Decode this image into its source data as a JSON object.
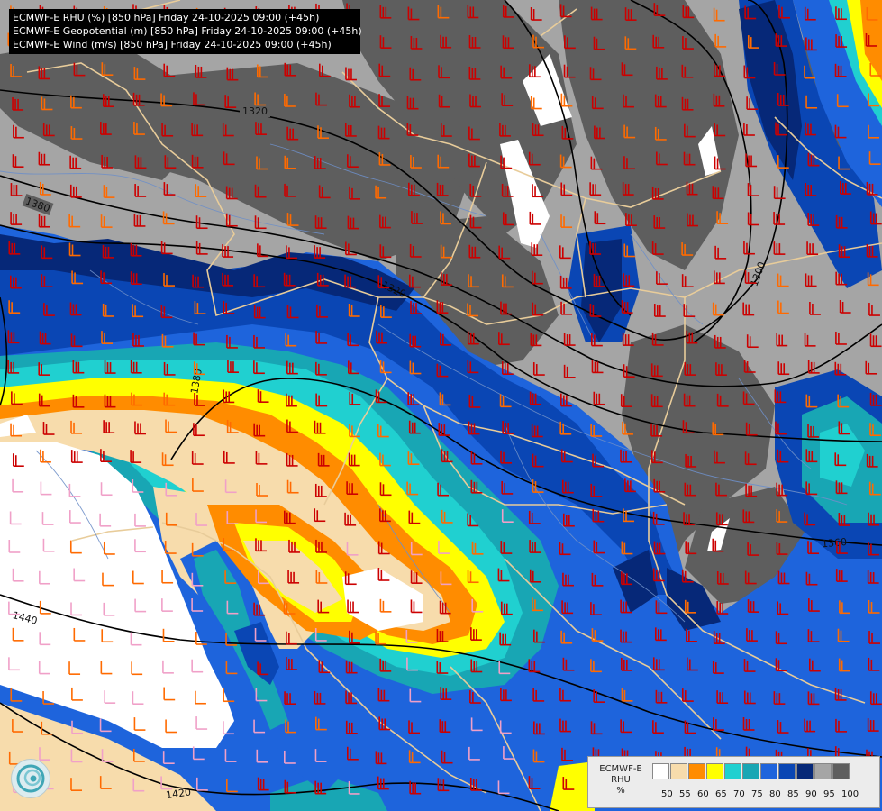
{
  "header": {
    "lines": [
      "ECMWF-E RHU (%) [850 hPa] Friday 24-10-2025 09:00 (+45h)",
      "ECMWF-E Geopotential (m) [850 hPa] Friday 24-10-2025 09:00 (+45h)",
      "ECMWF-E Wind (m/s) [850 hPa] Friday 24-10-2025 09:00 (+45h)"
    ]
  },
  "legend": {
    "model": "ECMWF-E",
    "variable": "RHU",
    "unit": "%",
    "ticks": [
      "50",
      "55",
      "60",
      "65",
      "70",
      "75",
      "80",
      "85",
      "90",
      "95",
      "100"
    ],
    "colors": [
      "#ffffff",
      "#f7dcac",
      "#ff8c00",
      "#ffff00",
      "#20d0d0",
      "#18a6b4",
      "#1e64dc",
      "#0a46b4",
      "#062878",
      "#a5a5a5",
      "#5e5e5e"
    ]
  },
  "contours": {
    "labels": [
      "1320",
      "1380",
      "1320",
      "1300",
      "1380",
      "1440",
      "1420",
      "1360"
    ]
  },
  "palette": {
    "land_border": "#e8cc9a",
    "river": "#6e8fc8",
    "contour": "#000000",
    "barb_strong": "#cc0000",
    "barb_medium": "#ff6a00",
    "barb_light": "#f0a0c8"
  },
  "logo": {
    "icon": "organization-logo-icon"
  }
}
